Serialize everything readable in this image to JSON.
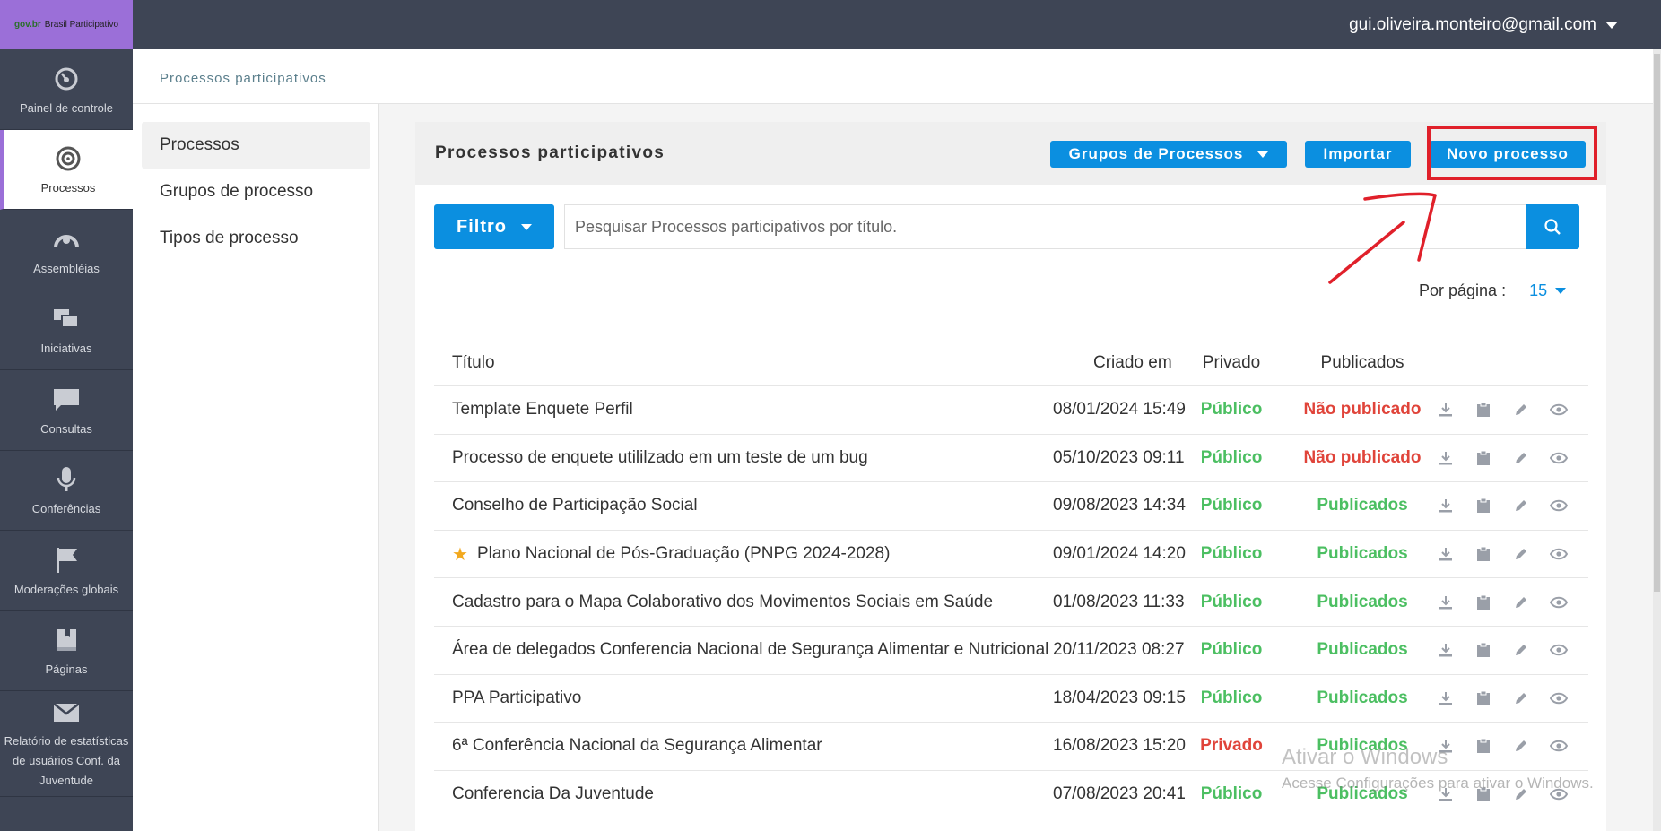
{
  "app": {
    "logo_mark": "gov.br",
    "logo_text": "Brasil Participativo",
    "user_email": "gui.oliveira.monteiro@gmail.com"
  },
  "sidebar": {
    "items": [
      {
        "label": "Painel de controle",
        "icon": "dashboard-icon"
      },
      {
        "label": "Processos",
        "icon": "target-icon",
        "active": true
      },
      {
        "label": "Assembléias",
        "icon": "assembly-icon"
      },
      {
        "label": "Iniciativas",
        "icon": "chat-bubbles-icon"
      },
      {
        "label": "Consultas",
        "icon": "speech-bubble-icon"
      },
      {
        "label": "Conferências",
        "icon": "microphone-icon"
      },
      {
        "label": "Moderações globais",
        "icon": "flag-icon"
      },
      {
        "label": "Páginas",
        "icon": "book-icon"
      },
      {
        "label": "Relatório de estatísticas de usuários Conf. da Juventude",
        "icon": "envelope-icon"
      }
    ]
  },
  "breadcrumb": "Processos participativos",
  "subnav": {
    "items": [
      "Processos",
      "Grupos de processo",
      "Tipos de processo"
    ]
  },
  "card": {
    "title": "Processos participativos",
    "groups_button": "Grupos de Processos",
    "import_button": "Importar",
    "new_button": "Novo processo",
    "filter_button": "Filtro",
    "search_placeholder": "Pesquisar Processos participativos por título.",
    "per_page_label": "Por página :",
    "per_page_value": "15"
  },
  "table": {
    "headers": {
      "title": "Título",
      "created": "Criado em",
      "private": "Privado",
      "published": "Publicados"
    },
    "rows": [
      {
        "title": "Template Enquete Perfil",
        "created": "08/01/2024 15:49",
        "private": "Público",
        "published": "Não publicado",
        "starred": false
      },
      {
        "title": "Processo de enquete utililzado em um teste de um bug",
        "created": "05/10/2023 09:11",
        "private": "Público",
        "published": "Não publicado",
        "starred": false
      },
      {
        "title": "Conselho de Participação Social",
        "created": "09/08/2023 14:34",
        "private": "Público",
        "published": "Publicados",
        "starred": false
      },
      {
        "title": "Plano Nacional de Pós-Graduação (PNPG 2024-2028)",
        "created": "09/01/2024 14:20",
        "private": "Público",
        "published": "Publicados",
        "starred": true
      },
      {
        "title": "Cadastro para o Mapa Colaborativo dos Movimentos Sociais em Saúde",
        "created": "01/08/2023 11:33",
        "private": "Público",
        "published": "Publicados",
        "starred": false
      },
      {
        "title": "Área de delegados Conferencia Nacional de Segurança Alimentar e Nutricional",
        "created": "20/11/2023 08:27",
        "private": "Público",
        "published": "Publicados",
        "starred": false
      },
      {
        "title": "PPA Participativo",
        "created": "18/04/2023 09:15",
        "private": "Público",
        "published": "Publicados",
        "starred": false
      },
      {
        "title": "6ª Conferência Nacional da Segurança Alimentar",
        "created": "16/08/2023 15:20",
        "private": "Privado",
        "published": "Publicados",
        "starred": false
      },
      {
        "title": "Conferencia Da Juventude",
        "created": "07/08/2023 20:41",
        "private": "Público",
        "published": "Publicados",
        "starred": false
      }
    ]
  },
  "watermark": {
    "line1": "Ativar o Windows",
    "line2": "Acesse Configurações para ativar o Windows."
  },
  "colors": {
    "sidebar_bg": "#3e4555",
    "accent_purple": "#9b6fd8",
    "primary_blue": "#0b8fe0",
    "green": "#4cbf62",
    "red": "#e0443a",
    "annotation_red": "#e0202a"
  }
}
